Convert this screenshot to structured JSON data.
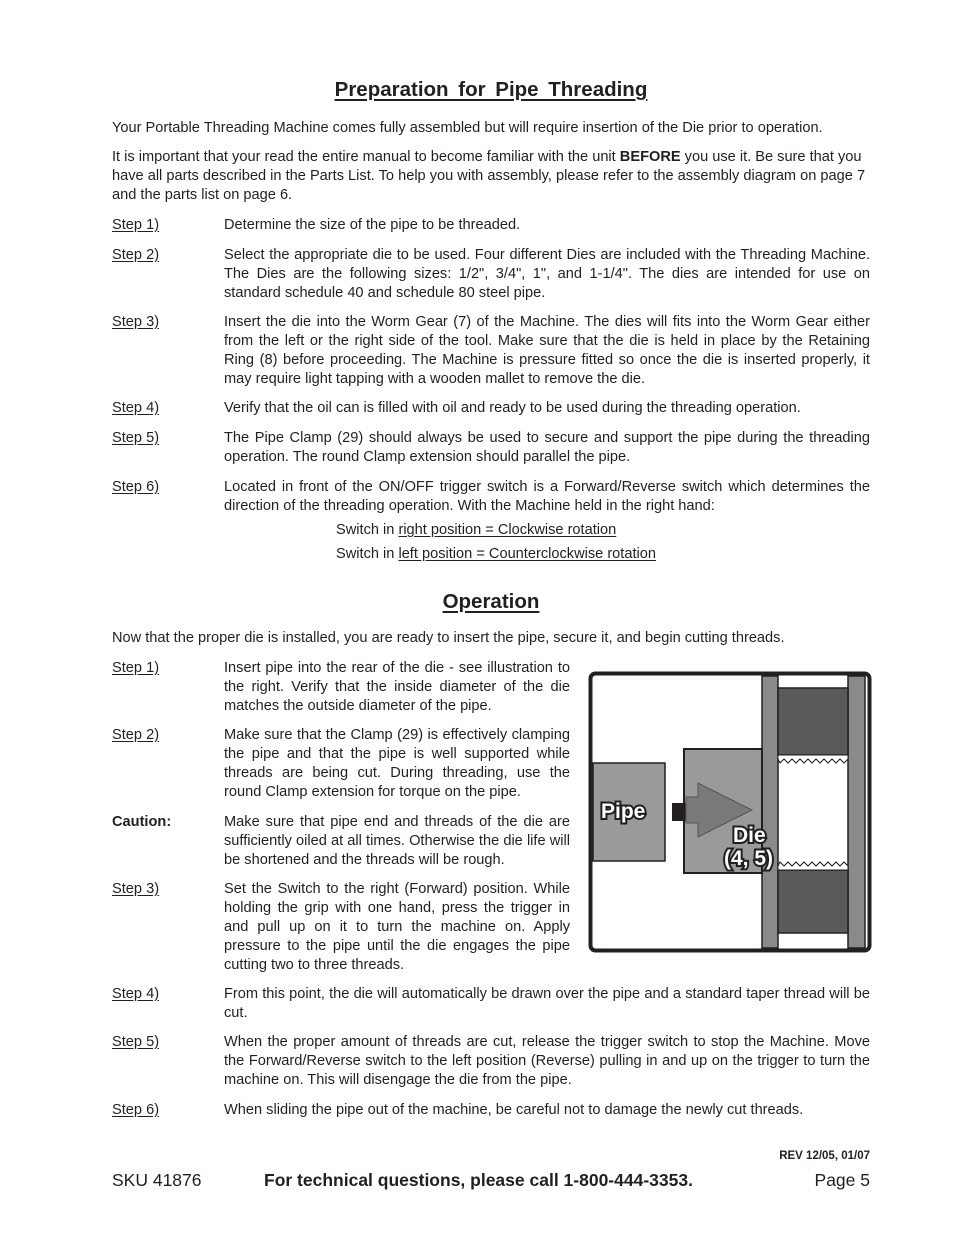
{
  "prep": {
    "title": "Preparation for Pipe Threading",
    "intro1": "Your Portable Threading Machine comes fully assembled but will require insertion of the Die prior to operation.",
    "intro2_a": "It is important that your read the entire manual to become familiar with the unit ",
    "intro2_bold": "BEFORE",
    "intro2_b": " you use it.  Be sure that you have all parts described in the Parts List.  To help you with assembly, please refer to the assembly diagram on page 7 and the parts list on page 6.",
    "steps": [
      {
        "label": "Step 1)",
        "text": "Determine the size of the pipe to be threaded."
      },
      {
        "label": "Step 2)",
        "text": "Select the appropriate die to be used.  Four different Dies are included with the Threading Machine. The Dies are the following sizes: 1/2\", 3/4\", 1\", and 1-1/4\".  The dies are intended for use on standard schedule 40 and schedule 80 steel pipe."
      },
      {
        "label": "Step 3)",
        "text": "Insert the die into the Worm Gear (7) of the Machine.  The dies will fits into the Worm Gear either from the left or the right side of the tool.  Make sure that the die is held in place by the Retaining Ring (8) before proceeding.  The Machine is pressure fitted so once the die is inserted properly, it may require light tapping with a wooden mallet to remove the die."
      },
      {
        "label": "Step 4)",
        "text": "Verify that the oil can is filled with oil and ready to be used during the threading operation."
      },
      {
        "label": "Step 5)",
        "text": "The Pipe Clamp (29) should always be used to secure and support the pipe during the threading operation.  The round Clamp extension should parallel the pipe."
      },
      {
        "label": "Step 6)",
        "text": "Located in front of the ON/OFF trigger switch is a Forward/Reverse switch which determines the direction of the threading operation.  With the Machine held in the right hand:"
      }
    ],
    "switch_right_prefix": "Switch in ",
    "switch_right_u": "right position = Clockwise rotation",
    "switch_left_prefix": "Switch in ",
    "switch_left_u": "left position = Counterclockwise rotation"
  },
  "operation": {
    "title": "Operation",
    "intro": "Now that the proper die is installed, you are ready to insert the pipe, secure it, and begin cutting threads.",
    "steps": [
      {
        "label": "Step 1)",
        "text": "Insert pipe into the rear of the die - see illustration to the right.  Verify that the inside diameter of the die matches the outside diameter of the pipe."
      },
      {
        "label": "Step 2)",
        "text": "Make sure that the Clamp (29) is effectively clamping the pipe and that the pipe is well supported while threads are being cut.  During threading, use the round Clamp extension for torque on the pipe."
      },
      {
        "label": "Caution:",
        "text": "Make sure that pipe end and threads of the die are sufficiently oiled at all times. Otherwise the die life will be shortened and the threads will be rough."
      },
      {
        "label": "Step 3)",
        "text": "Set the Switch to the right (Forward) position.  While holding the grip with one hand, press the trigger in and pull up on it to turn the machine on.  Apply pressure to the pipe until the die engages the pipe cutting two to three threads."
      },
      {
        "label": "Step 4)",
        "text": "From this point, the die will automatically be drawn over the pipe and a standard taper thread will be cut."
      },
      {
        "label": "Step 5)",
        "text": "When the proper amount of threads are cut, release the trigger switch to stop the Machine.  Move the Forward/Reverse switch to the left position (Reverse) pulling in and up on the trigger to turn the machine on.  This will disengage the die from the pipe."
      },
      {
        "label": "Step 6)",
        "text": "When sliding the pipe out of the machine, be careful not to damage the newly cut threads."
      }
    ],
    "illustration": {
      "pipe_label": "Pipe",
      "die_label_1": "Die",
      "die_label_2": "(4, 5)"
    }
  },
  "footer": {
    "rev": "REV 12/05, 01/07",
    "sku": "SKU 41876",
    "support": "For technical questions, please call 1-800-444-3353.",
    "page": "Page 5"
  }
}
